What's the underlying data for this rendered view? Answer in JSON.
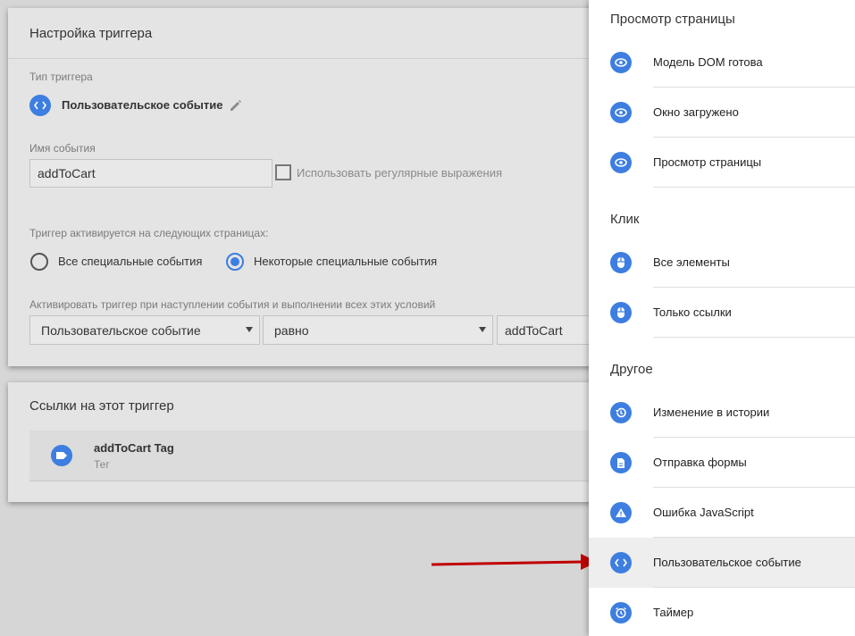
{
  "trigger_config": {
    "title": "Настройка триггера",
    "type_label": "Тип триггера",
    "type_name": "Пользовательское событие",
    "event_name_label": "Имя события",
    "event_name_value": "addToCart",
    "regex_label": "Использовать регулярные выражения",
    "regex_checked": false,
    "fires_on_label": "Триггер активируется на следующих страницах:",
    "radio_all": "Все специальные события",
    "radio_some": "Некоторые специальные события",
    "radio_selected": "some",
    "condition_label": "Активировать триггер при наступлении события и выполнении всех этих условий",
    "condition_variable": "Пользовательское событие",
    "condition_operator": "равно",
    "condition_value": "addToCart"
  },
  "references": {
    "title": "Ссылки на этот триггер",
    "items": [
      {
        "name": "addToCart Tag",
        "type": "Тег"
      }
    ]
  },
  "trigger_types": {
    "sections": [
      {
        "heading": "Просмотр страницы",
        "items": [
          {
            "label": "Модель DOM готова",
            "icon": "eye-icon"
          },
          {
            "label": "Окно загружено",
            "icon": "eye-icon"
          },
          {
            "label": "Просмотр страницы",
            "icon": "eye-icon"
          }
        ]
      },
      {
        "heading": "Клик",
        "items": [
          {
            "label": "Все элементы",
            "icon": "mouse-icon"
          },
          {
            "label": "Только ссылки",
            "icon": "mouse-icon"
          }
        ]
      },
      {
        "heading": "Другое",
        "items": [
          {
            "label": "Изменение в истории",
            "icon": "history-icon"
          },
          {
            "label": "Отправка формы",
            "icon": "document-icon"
          },
          {
            "label": "Ошибка JavaScript",
            "icon": "warning-icon"
          },
          {
            "label": "Пользовательское событие",
            "icon": "code-icon",
            "highlighted": true
          },
          {
            "label": "Таймер",
            "icon": "alarm-clock-icon"
          }
        ]
      }
    ]
  },
  "colors": {
    "accent": "#3d7ee0",
    "arrow": "#c00000"
  }
}
